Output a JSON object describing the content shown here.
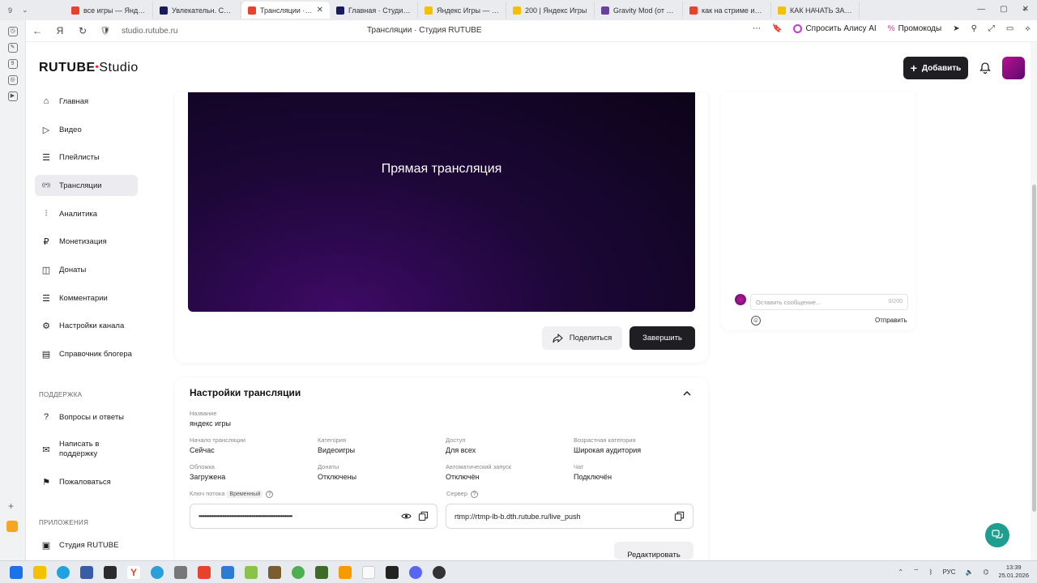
{
  "browser": {
    "tab_count": "9",
    "tabs": [
      {
        "label": "все игры — Яндекс",
        "color": "#e8412c"
      },
      {
        "label": "Увлекательн. Смотреть",
        "color": "#1a1a60"
      },
      {
        "label": "Трансляции · Студия",
        "color": "#e8412c",
        "active": true
      },
      {
        "label": "Главная · Студия RU",
        "color": "#1a1a60"
      },
      {
        "label": "Яндекс Игры — Игр",
        "color": "#f5c000"
      },
      {
        "label": "200 | Яндекс Игры",
        "color": "#f5c000"
      },
      {
        "label": "Gravity Mod (от Aut",
        "color": "#6b3fa0"
      },
      {
        "label": "как на стриме испр",
        "color": "#e8412c"
      },
      {
        "label": "КАК НАЧАТЬ ЗАРА",
        "color": "#f5c000"
      }
    ],
    "url": "studio.rutube.ru",
    "page_title": "Трансляции · Студия RUTUBE",
    "alice_label": "Спросить Алису AI",
    "promo_label": "Промокоды"
  },
  "app": {
    "logo_main": "RUTUBE",
    "logo_studio": "Studio",
    "add_label": "Добавить"
  },
  "nav": {
    "items": [
      {
        "label": "Главная",
        "icon": "home-icon"
      },
      {
        "label": "Видео",
        "icon": "video-icon"
      },
      {
        "label": "Плейлисты",
        "icon": "playlist-icon"
      },
      {
        "label": "Трансляции",
        "icon": "broadcast-icon",
        "active": true
      },
      {
        "label": "Аналитика",
        "icon": "analytics-icon"
      },
      {
        "label": "Монетизация",
        "icon": "monetization-icon"
      },
      {
        "label": "Донаты",
        "icon": "donate-icon"
      },
      {
        "label": "Комментарии",
        "icon": "comment-icon"
      },
      {
        "label": "Настройки канала",
        "icon": "gear-icon"
      },
      {
        "label": "Справочник блогера",
        "icon": "book-icon"
      }
    ],
    "support_heading": "ПОДДЕРЖКА",
    "support_items": [
      {
        "label": "Вопросы и ответы",
        "icon": "question-icon"
      },
      {
        "label": "Написать в поддержку",
        "icon": "mail-icon"
      },
      {
        "label": "Пожаловаться",
        "icon": "flag-icon"
      }
    ],
    "apps_heading": "ПРИЛОЖЕНИЯ",
    "apps_items": [
      {
        "label": "Студия RUTUBE",
        "icon": "studio-icon"
      }
    ]
  },
  "player": {
    "title": "Прямая трансляция",
    "share_label": "Поделиться",
    "finish_label": "Завершить"
  },
  "chat": {
    "placeholder": "Оставить сообщение...",
    "counter": "0/200",
    "send_label": "Отправить"
  },
  "settings": {
    "title": "Настройки трансляции",
    "name_label": "Название",
    "name_value": "яндекс игры",
    "fields": [
      {
        "label": "Начало трансляции",
        "value": "Сейчас"
      },
      {
        "label": "Категория",
        "value": "Видеоигры"
      },
      {
        "label": "Доступ",
        "value": "Для всех"
      },
      {
        "label": "Возрастная категория",
        "value": "Широкая аудитория"
      },
      {
        "label": "Обложка",
        "value": "Загружена"
      },
      {
        "label": "Донаты",
        "value": "Отключены"
      },
      {
        "label": "Автоматический запуск",
        "value": "Отключён"
      },
      {
        "label": "Чат",
        "value": "Подключён"
      }
    ],
    "stream_key_label": "Ключ потока",
    "stream_key_badge": "Временный",
    "stream_key_value": "••••••••••••••••••••••••••••••••••••••••••••••••••••••••••••••••",
    "server_label": "Сервер",
    "server_value": "rtmp://rtmp-lb-b.dth.rutube.ru/live_push",
    "edit_label": "Редактировать"
  },
  "taskbar": {
    "time": "13:39",
    "date": "25.01.2026",
    "lang": "РУС"
  }
}
